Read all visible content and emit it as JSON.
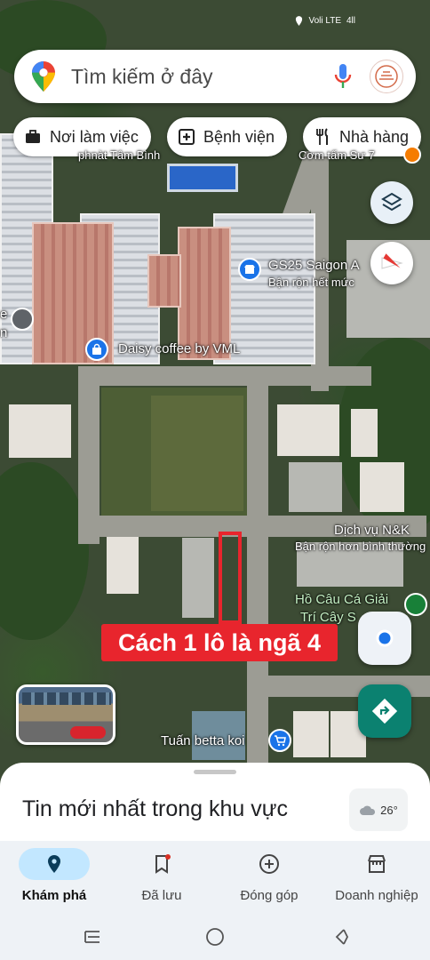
{
  "status_bar": {
    "network": "Voli LTE",
    "signal": "4ll"
  },
  "search": {
    "placeholder": "Tìm kiếm ở đây"
  },
  "chips": [
    {
      "label": "Nơi làm việc",
      "icon": "briefcase-icon"
    },
    {
      "label": "Bệnh viện",
      "icon": "hospital-icon"
    },
    {
      "label": "Nhà hàng",
      "icon": "restaurant-icon"
    }
  ],
  "map_labels": {
    "top_left": "phnàt Tâm Bình",
    "top_right": "Cơm tấm Sư 7",
    "gs25_name": "GS25 Saigon A",
    "gs25_status": "Bận rộn hết mức",
    "daisy": "Daisy coffee by VML",
    "dichvu_name": "Dịch vụ N&K",
    "dichvu_status": "Bận rộn hơn bình thường",
    "hocau_line1": "Hồ Câu Cá Giải",
    "hocau_line2": "Trí Cây S",
    "tuan": "Tuấn betta koi",
    "left_edge_1": "e",
    "left_edge_2": "n"
  },
  "annotation": {
    "text": "Cách 1 lô là ngã 4",
    "color": "#e8252d"
  },
  "sheet": {
    "title": "Tin mới nhất trong khu vực",
    "temperature": "26°"
  },
  "nav": [
    {
      "label": "Khám phá",
      "icon": "explore-pin-icon",
      "active": true
    },
    {
      "label": "Đã lưu",
      "icon": "saved-bookmark-icon",
      "active": false
    },
    {
      "label": "Đóng góp",
      "icon": "contribute-plus-icon",
      "active": false
    },
    {
      "label": "Doanh nghiệp",
      "icon": "business-store-icon",
      "active": false
    }
  ],
  "colors": {
    "accent_blue": "#1a73e8",
    "nav_active": "#c2e7ff",
    "directions_teal": "#0b8170"
  }
}
